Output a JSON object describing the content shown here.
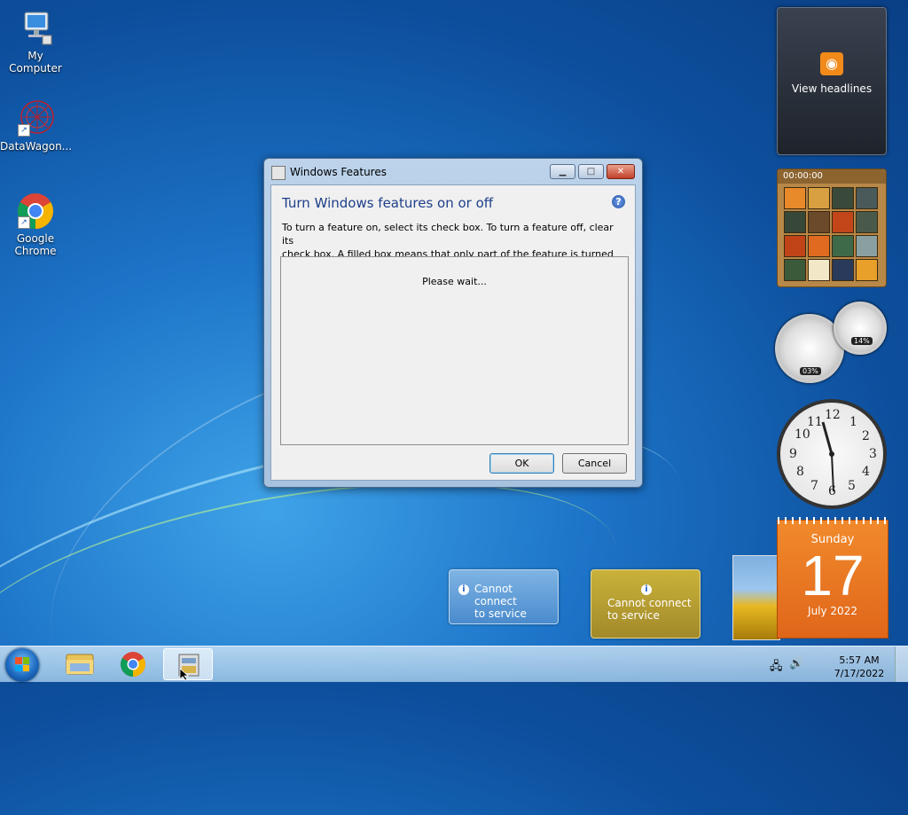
{
  "desktop": {
    "icons": [
      {
        "label": "My Computer"
      },
      {
        "label": "DataWagon..."
      },
      {
        "label": "Google Chrome"
      }
    ]
  },
  "gadgets": {
    "feed": {
      "label": "View headlines"
    },
    "puzzle": {
      "timer": "00:00:00"
    },
    "meter": {
      "cpu": "03%",
      "memory": "14%"
    },
    "clock": {
      "numbers": [
        "12",
        "1",
        "2",
        "3",
        "4",
        "5",
        "6",
        "7",
        "8",
        "9",
        "10",
        "11"
      ]
    },
    "calendar": {
      "weekday": "Sunday",
      "day": "17",
      "month_year": "July 2022"
    },
    "weather": [
      {
        "text_line1": "Cannot connect",
        "text_line2": "to service"
      },
      {
        "text_line1": "Cannot connect",
        "text_line2": "to service"
      }
    ]
  },
  "dialog": {
    "title": "Windows Features",
    "heading": "Turn Windows features on or off",
    "instructions_line1": "To turn a feature on, select its check box. To turn a feature off, clear its",
    "instructions_line2": "check box. A filled box means that only part of the feature is turned on.",
    "status": "Please wait...",
    "ok_label": "OK",
    "cancel_label": "Cancel",
    "help_glyph": "?"
  },
  "taskbar": {
    "items": [
      "windows-explorer",
      "google-chrome",
      "windows-features"
    ],
    "time": "5:57 AM",
    "date": "7/17/2022"
  },
  "colors": {
    "accent": "#1e3f8a",
    "calendar": "#e96f1f"
  }
}
